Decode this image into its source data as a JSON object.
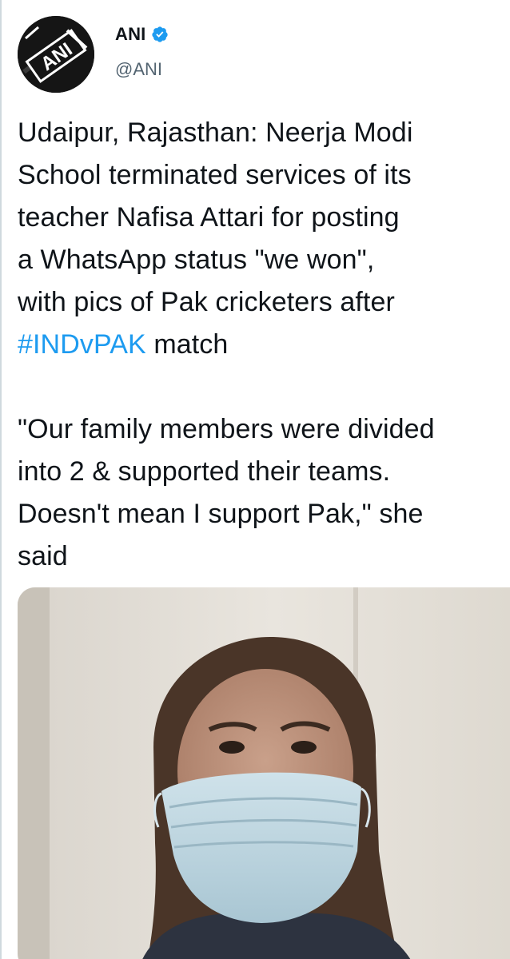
{
  "tweet": {
    "author": {
      "display_name": "ANI",
      "handle": "@ANI",
      "verified": true,
      "avatar_text": "ANI"
    },
    "text_lines": [
      "Udaipur, Rajasthan: Neerja Modi",
      "School terminated services of its",
      "teacher Nafisa Attari for posting",
      "a WhatsApp status \"we won\",",
      "with pics of Pak cricketers after"
    ],
    "hashtag": "#INDvPAK",
    "hashtag_suffix": " match",
    "quote_lines": [
      "\"Our family members were divided",
      "into 2 & supported their teams.",
      "Doesn't mean I support Pak,\" she",
      "said"
    ],
    "media": {
      "description_icon": "photo-icon"
    }
  },
  "colors": {
    "accent": "#1d9bf0",
    "text": "#0f1419",
    "secondary": "#536471"
  }
}
